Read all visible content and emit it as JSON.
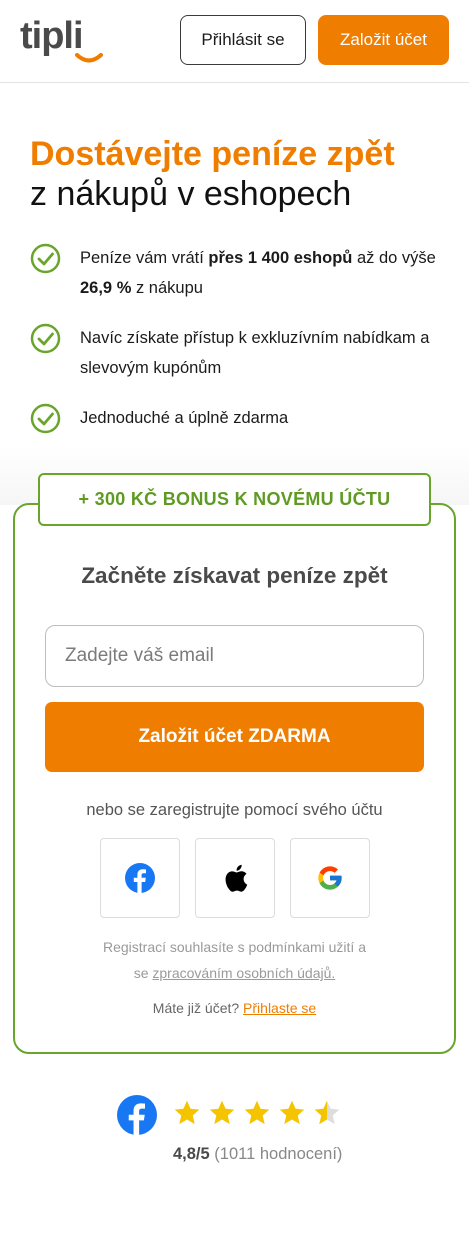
{
  "header": {
    "logo_text": "tipli",
    "login_label": "Přihlásit se",
    "register_label": "Založit účet"
  },
  "hero": {
    "title_accent": "Dostávejte peníze zpět",
    "title_rest": "z nákupů v eshopech",
    "benefits": [
      {
        "prefix": "Peníze vám vrátí ",
        "bold1": "přes 1 400 eshopů",
        "middle": " až do výše ",
        "bold2": "26,9 %",
        "suffix": " z nákupu"
      },
      {
        "text": "Navíc získate přístup k exkluzívním nabídkam a slevovým kupónům"
      },
      {
        "text": "Jednoduché a úplně zdarma"
      }
    ]
  },
  "signup": {
    "bonus": "+ 300 KČ BONUS K NOVÉMU ÚČTU",
    "title": "Začněte získavat peníze zpět",
    "email_placeholder": "Zadejte váš email",
    "cta_label": "Založit účet ZDARMA",
    "social_label": "nebo se zaregistrujte pomocí svého účtu",
    "social_icons": [
      "facebook-icon",
      "apple-icon",
      "google-icon"
    ],
    "terms_line1": "Registrací souhlasíte s podmínkami užití a",
    "terms_line2_prefix": "se ",
    "terms_link": "zpracováním osobních údajů.",
    "already_text": "Máte již účet? ",
    "already_link": "Přihlaste se"
  },
  "rating": {
    "score": "4,8/5",
    "count": "(1011 hodnocení)",
    "stars_value": 4.5,
    "stars_max": 5
  },
  "colors": {
    "accent": "#ef7d00",
    "green": "#6aa52b",
    "facebook": "#1877f2"
  }
}
